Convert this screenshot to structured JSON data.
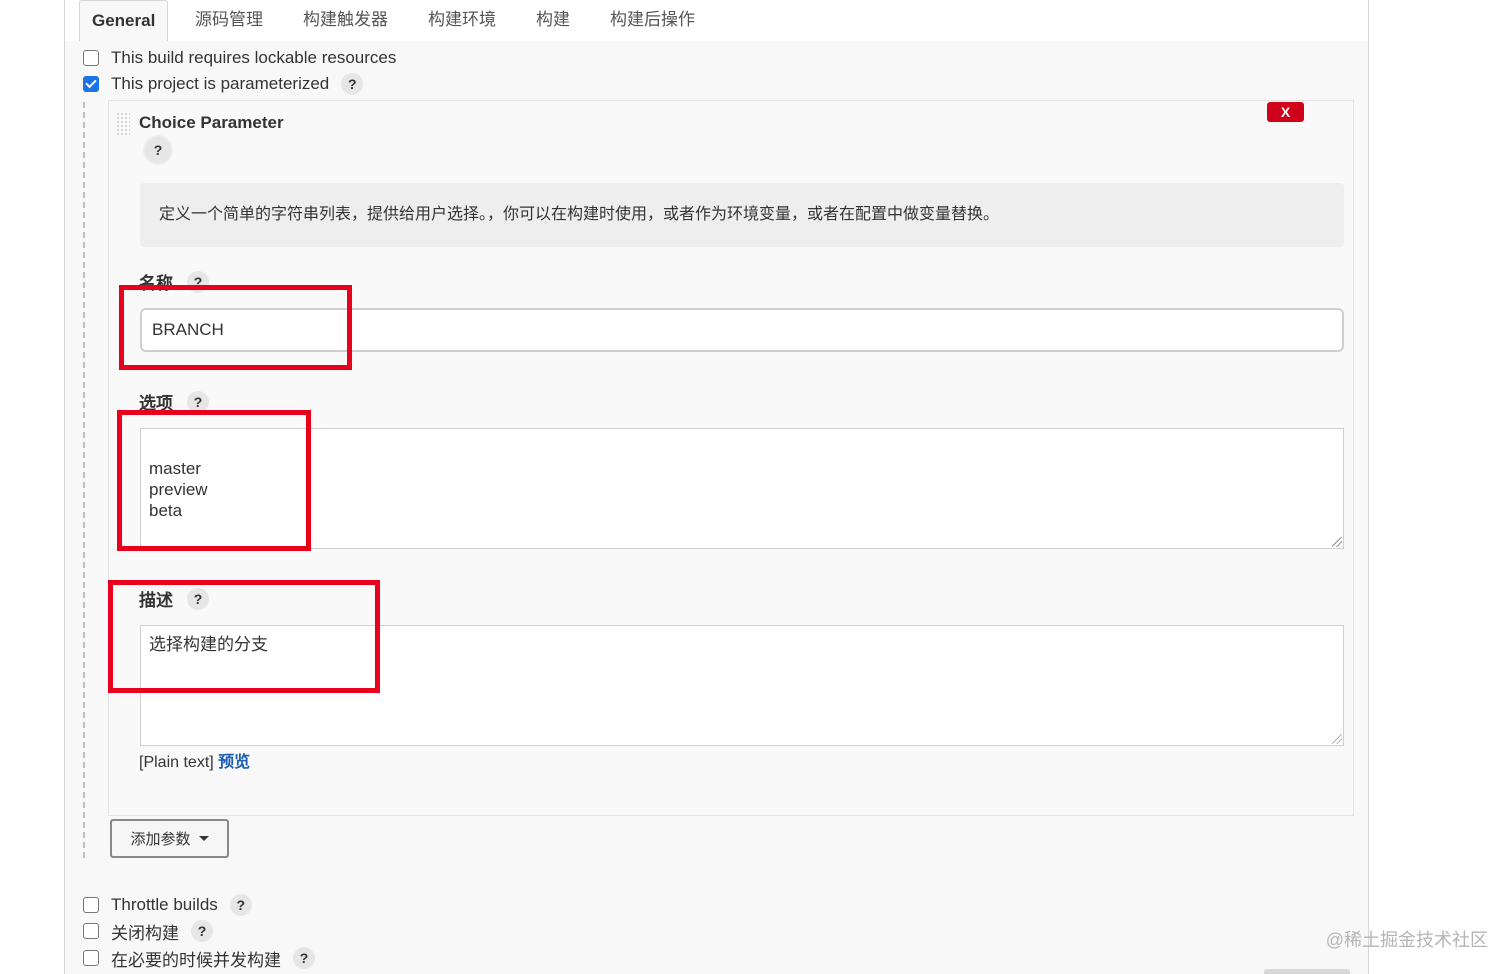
{
  "tabs": [
    {
      "label": "General",
      "active": true
    },
    {
      "label": "源码管理",
      "active": false
    },
    {
      "label": "构建触发器",
      "active": false
    },
    {
      "label": "构建环境",
      "active": false
    },
    {
      "label": "构建",
      "active": false
    },
    {
      "label": "构建后操作",
      "active": false
    }
  ],
  "options_top": {
    "lockable": {
      "label": "This build requires lockable resources",
      "checked": false
    },
    "parameterized": {
      "label": "This project is parameterized",
      "checked": true
    }
  },
  "parameter": {
    "title": "Choice Parameter",
    "close_label": "X",
    "description_help": "定义一个简单的字符串列表，提供给用户选择。，你可以在构建时使用，或者作为环境变量，或者在配置中做变量替换。",
    "name_label": "名称",
    "name_value": "BRANCH",
    "choices_label": "选项",
    "choices_value": "master\npreview\nbeta",
    "desc_label": "描述",
    "desc_value": "选择构建的分支",
    "plain_text": "[Plain text]",
    "preview_link": "预览"
  },
  "add_param_label": "添加参数",
  "options_bottom": {
    "throttle": {
      "label": "Throttle builds",
      "checked": false
    },
    "disable": {
      "label": "关闭构建",
      "checked": false
    },
    "concurrent": {
      "label": "在必要的时候并发构建",
      "checked": false
    }
  },
  "help_glyph": "?",
  "watermark": "@稀土掘金技术社区",
  "colors": {
    "annotation": "#e8001c",
    "close_button": "#d0021b",
    "link": "#1a5fb4",
    "checkbox_checked": "#1a73e8"
  }
}
